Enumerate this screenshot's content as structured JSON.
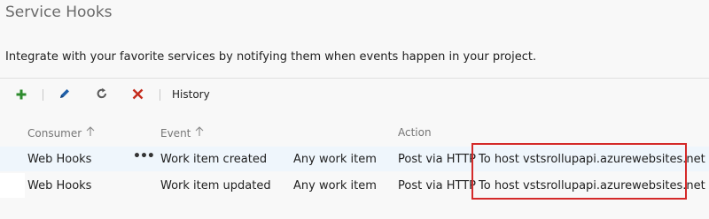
{
  "header": {
    "title": "Service Hooks"
  },
  "description": "Integrate with your favorite services by notifying them when events happen in your project.",
  "toolbar": {
    "add_icon": "plus-icon",
    "edit_icon": "pencil-icon",
    "refresh_icon": "refresh-icon",
    "delete_icon": "x-delete-icon",
    "history_label": "History",
    "colors": {
      "add": "#2e8b2e",
      "edit": "#1f5fa8",
      "refresh": "#5a5a5a",
      "delete": "#c42b1c"
    }
  },
  "grid": {
    "columns": {
      "consumer": "Consumer",
      "event": "Event",
      "action": "Action"
    },
    "rows": [
      {
        "consumer": "Web Hooks",
        "more": "•••",
        "event": "Work item created",
        "filter": "Any work item",
        "action": "Post via HTTP",
        "target": "To host vstsrollupapi.azurewebsites.net",
        "selected": true
      },
      {
        "consumer": "Web Hooks",
        "more": "",
        "event": "Work item updated",
        "filter": "Any work item",
        "action": "Post via HTTP",
        "target": "To host vstsrollupapi.azurewebsites.net",
        "selected": false
      }
    ]
  },
  "colors": {
    "selected_row": "#eff6fc",
    "highlight_border": "#d42a2a"
  }
}
